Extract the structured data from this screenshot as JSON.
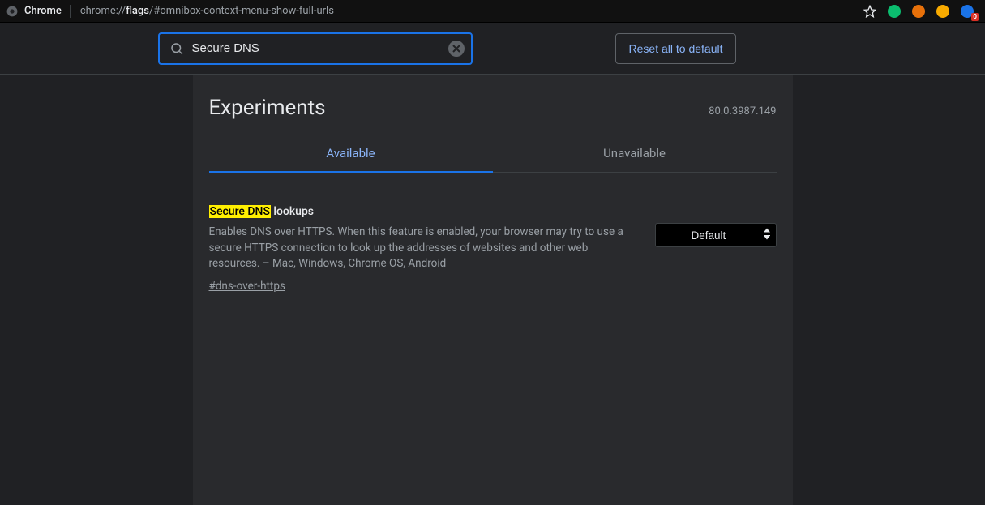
{
  "chrome": {
    "label": "Chrome",
    "url_prefix": "chrome://",
    "url_bold": "flags",
    "url_suffix": "/#omnibox-context-menu-show-full-urls",
    "extensions_badge": "0"
  },
  "toolbar": {
    "search_value": "Secure DNS",
    "reset_label": "Reset all to default"
  },
  "page": {
    "title": "Experiments",
    "version": "80.0.3987.149"
  },
  "tabs": {
    "available": "Available",
    "unavailable": "Unavailable"
  },
  "flag": {
    "title_highlight": "Secure DNS",
    "title_rest": " lookups",
    "description": "Enables DNS over HTTPS. When this feature is enabled, your browser may try to use a secure HTTPS connection to look up the addresses of websites and other web resources. – Mac, Windows, Chrome OS, Android",
    "hash": "#dns-over-https",
    "select_value": "Default"
  }
}
